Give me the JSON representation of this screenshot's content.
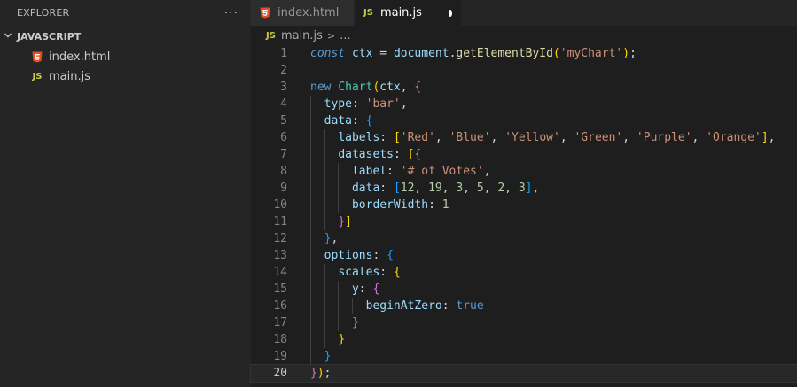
{
  "sidebar": {
    "title": "EXPLORER",
    "more": "···",
    "section": "JAVASCRIPT",
    "files": [
      {
        "name": "index.html",
        "icon": "html5-icon"
      },
      {
        "name": "main.js",
        "icon": "js-icon"
      }
    ]
  },
  "tabs": [
    {
      "label": "index.html",
      "icon": "html5-icon",
      "active": false,
      "modified": true
    },
    {
      "label": "main.js",
      "icon": "js-icon",
      "active": true,
      "modified": true
    }
  ],
  "breadcrumb": {
    "icon_text": "JS",
    "file": "main.js",
    "separator": ">",
    "rest": "..."
  },
  "icons": {
    "js_text": "JS",
    "html_text": "5",
    "chevron": "v"
  },
  "code": {
    "current_line": 20,
    "lines": [
      "const ctx = document.getElementById('myChart');",
      "",
      "new Chart(ctx, {",
      "  type: 'bar',",
      "  data: {",
      "    labels: ['Red', 'Blue', 'Yellow', 'Green', 'Purple', 'Orange'],",
      "    datasets: [{",
      "      label: '# of Votes',",
      "      data: [12, 19, 3, 5, 2, 3],",
      "      borderWidth: 1",
      "    }]",
      "  },",
      "  options: {",
      "    scales: {",
      "      y: {",
      "        beginAtZero: true",
      "      }",
      "    }",
      "  }",
      "});"
    ]
  },
  "colors": {
    "keyword": "#569cd6",
    "string": "#ce9178",
    "number": "#b5cea8",
    "function": "#dcdcaa",
    "class": "#4ec9b0",
    "property": "#9cdcfe",
    "bracket1": "#ffd700",
    "bracket2": "#da70d6",
    "bracket3": "#179fff"
  }
}
